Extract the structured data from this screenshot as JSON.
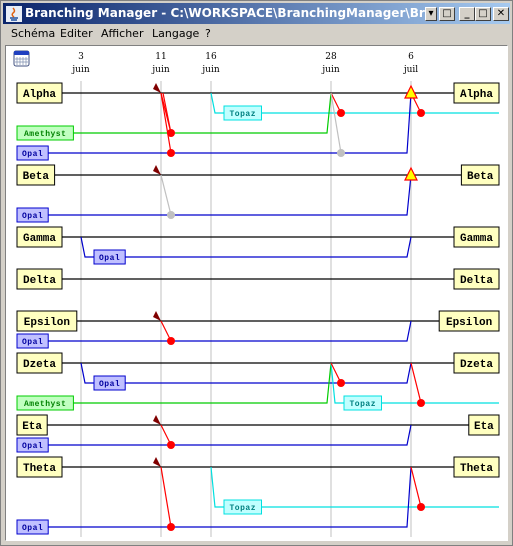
{
  "window": {
    "title": "Branching Manager - C:\\WORKSPACE\\BranchingManager\\BranchingSche",
    "controls": {
      "menu": "▾",
      "restore_small": "□",
      "minimize": "_",
      "maximize": "□",
      "close": "✕"
    }
  },
  "menu": [
    "Schéma",
    "Editer",
    "Afficher",
    "Langage",
    "?"
  ],
  "toolbar": {
    "calendar_icon": "calendar-icon"
  },
  "timeline": {
    "dates": [
      {
        "day": "3",
        "month": "juin"
      },
      {
        "day": "11",
        "month": "juin"
      },
      {
        "day": "16",
        "month": "juin"
      },
      {
        "day": "28",
        "month": "juin"
      },
      {
        "day": "6",
        "month": "juil"
      }
    ]
  },
  "colors": {
    "main": "#000000",
    "opal": "#0000cc",
    "amethyst": "#00cc00",
    "topaz": "#00e0e0",
    "merge": "#ff0000",
    "merge_pending": "#c0c0c0",
    "marker": "#800000",
    "label_bg": "#ffffc0",
    "opal_bg": "#c0c0ff",
    "amethyst_bg": "#c0ffc0",
    "topaz_bg": "#c0ffff",
    "release_fill": "#ffff00",
    "release_stroke": "#ff0000"
  },
  "projects": [
    {
      "name": "Alpha",
      "branches": [
        {
          "name": "Topaz",
          "type": "topaz"
        },
        {
          "name": "Amethyst",
          "type": "amethyst"
        },
        {
          "name": "Opal",
          "type": "opal"
        }
      ]
    },
    {
      "name": "Beta",
      "branches": [
        {
          "name": "Opal",
          "type": "opal"
        }
      ]
    },
    {
      "name": "Gamma",
      "branches": [
        {
          "name": "Opal",
          "type": "opal"
        }
      ]
    },
    {
      "name": "Delta",
      "branches": []
    },
    {
      "name": "Epsilon",
      "branches": [
        {
          "name": "Opal",
          "type": "opal"
        }
      ]
    },
    {
      "name": "Dzeta",
      "branches": [
        {
          "name": "Opal",
          "type": "opal"
        },
        {
          "name": "Amethyst",
          "type": "amethyst"
        },
        {
          "name": "Topaz",
          "type": "topaz"
        }
      ]
    },
    {
      "name": "Eta",
      "branches": [
        {
          "name": "Opal",
          "type": "opal"
        }
      ]
    },
    {
      "name": "Theta",
      "branches": [
        {
          "name": "Topaz",
          "type": "topaz"
        },
        {
          "name": "Opal",
          "type": "opal"
        }
      ]
    }
  ]
}
